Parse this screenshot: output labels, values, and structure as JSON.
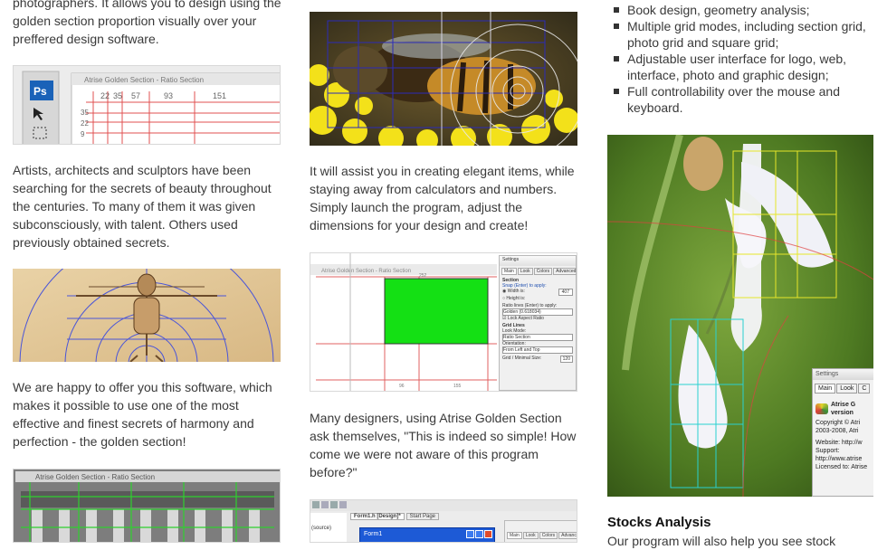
{
  "col1": {
    "p0": "photographers. It allows you to design using the golden section proportion visually over your preffered design software.",
    "shot1": {
      "ps_label": "Ps",
      "window_title": "Atrise Golden Section - Ratio Section",
      "ruler_ticks": [
        "22",
        "35",
        "57",
        "93",
        "151"
      ],
      "side_ticks": [
        "35",
        "22",
        "9"
      ]
    },
    "p1": "Artists, architects and sculptors have been searching for the secrets of beauty throughout the centuries. To many of them it was given subconsciously, with talent. Others used previously obtained secrets.",
    "p2": "We are happy to offer you this software, which makes it possible to use one of the most effective and finest secrets of harmony and perfection - the golden section!",
    "shot3": {
      "window_title": "Atrise Golden Section - Ratio Section"
    }
  },
  "col2": {
    "p1": "It will assist you in creating elegant items, while staying away from calculators and numbers. Simply launch the program, adjust the dimensions for your design and create!",
    "settings": {
      "title": "Settings",
      "tabs": [
        "Main",
        "Look",
        "Colors",
        "Advanced"
      ],
      "section_label": "Section",
      "snap_label": "Snap (Enter) to apply:",
      "width_label": "Width is:",
      "height_label": "Height is:",
      "width_value": "407",
      "ratio_label": "Ratio lines (Enter) to apply:",
      "ratio_value": "Golden (0.618034)",
      "lock_label": "Lock Aspect Ratio",
      "grid_label": "Grid Lines",
      "look_mode_label": "Look Mode:",
      "look_mode_value": "Ratio Section",
      "orientation_label": "Orientation:",
      "orientation_value": "From Left and Top",
      "grid_size_label": "Grid / Minimal Size:",
      "grid_size_value": "120",
      "window_title": "Atrise Golden Section - Ratio Section",
      "ruler_top": "252",
      "ruler_bottom": [
        "96",
        "155"
      ]
    },
    "p2": "Many designers, using Atrise Golden Section ask themselves, \"This is indeed so simple! How come we were not aware of this program before?\"",
    "designer": {
      "tab1": "Form1.h [Design]*",
      "tab2": "Start Page",
      "form_title": "Form1",
      "side": "(source)",
      "tabs": [
        "Main",
        "Look",
        "Colors",
        "Advanced"
      ]
    }
  },
  "col3": {
    "bullets": [
      "Book design, geometry analysis;",
      "Multiple grid modes, including section grid, photo grid and square grid;",
      "Adjustable user interface for logo, web, interface, photo and graphic design;",
      "Full controllability over the mouse and keyboard."
    ],
    "settings_overlay": {
      "title": "Settings",
      "tabs": [
        "Main",
        "Look",
        "C"
      ],
      "product": "Atrise G",
      "version": "version",
      "copyright1": "Copyright © Atri",
      "copyright2": "2003-2008, Atri",
      "website": "Website: http://w",
      "support": "Support:",
      "support_url": "http://www.atrise",
      "licensed": "Licensed to: Atrise"
    },
    "heading": "Stocks Analysis",
    "p_tail": "Our program will also help you see stock"
  }
}
